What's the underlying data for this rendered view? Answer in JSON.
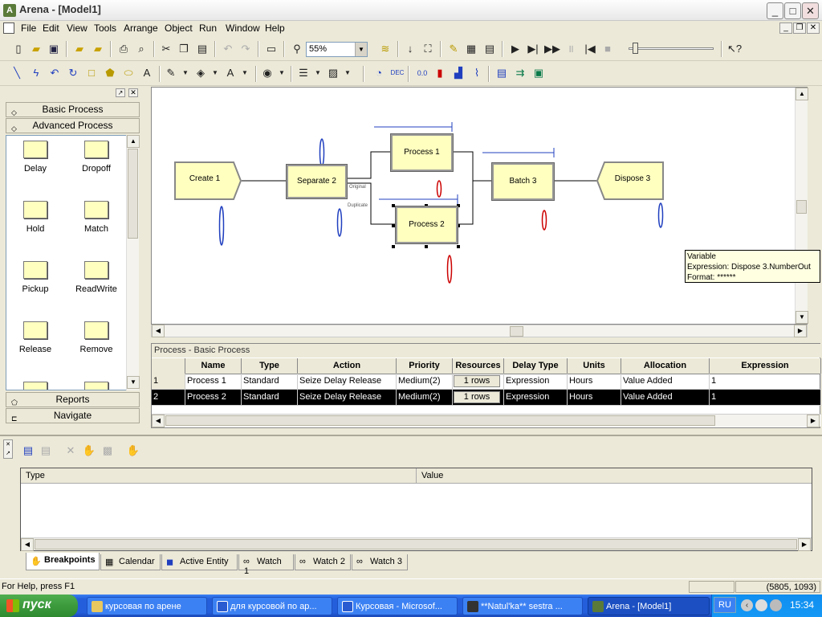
{
  "window": {
    "title": "Arena - [Model1]"
  },
  "menu": [
    "File",
    "Edit",
    "View",
    "Tools",
    "Arrange",
    "Object",
    "Run",
    "Window",
    "Help"
  ],
  "toolbar": {
    "zoom": "55%"
  },
  "project_bar": {
    "panels": [
      "Basic Process",
      "Advanced Process",
      "Reports",
      "Navigate"
    ],
    "shapes": [
      "Delay",
      "Dropoff",
      "Hold",
      "Match",
      "Pickup",
      "ReadWrite",
      "Release",
      "Remove"
    ]
  },
  "canvas": {
    "modules": {
      "create": "Create 1",
      "separate": "Separate 2",
      "process1": "Process 1",
      "process2": "Process 2",
      "batch": "Batch 3",
      "dispose": "Dispose 3"
    },
    "branch_labels": {
      "original": "Original",
      "duplicate": "Duplicate"
    },
    "tooltip": {
      "line1": "Variable",
      "line2": "Expression: Dispose 3.NumberOut",
      "line3": "Format: ******"
    }
  },
  "sheet": {
    "title": "Process - Basic Process",
    "columns": [
      "Name",
      "Type",
      "Action",
      "Priority",
      "Resources",
      "Delay Type",
      "Units",
      "Allocation",
      "Expression"
    ],
    "rows": [
      {
        "num": "1",
        "name": "Process 1",
        "type": "Standard",
        "action": "Seize Delay Release",
        "priority": "Medium(2)",
        "resources": "1 rows",
        "delay_type": "Expression",
        "units": "Hours",
        "allocation": "Value Added",
        "expression": "1"
      },
      {
        "num": "2",
        "name": "Process 2",
        "type": "Standard",
        "action": "Seize Delay Release",
        "priority": "Medium(2)",
        "resources": "1 rows",
        "delay_type": "Expression",
        "units": "Hours",
        "allocation": "Value Added",
        "expression": "1"
      }
    ]
  },
  "debug": {
    "columns": [
      "Type",
      "Value"
    ],
    "tabs": [
      "Breakpoints",
      "Calendar",
      "Active Entity",
      "Watch 1",
      "Watch 2",
      "Watch 3"
    ]
  },
  "status": {
    "help": "For Help, press F1",
    "coords": "(5805, 1093)"
  },
  "taskbar": {
    "start": "пуск",
    "tasks": [
      "курсовая по арене",
      "для курсовой по ар...",
      "Курсовая - Microsof...",
      "**Natul'ka** sestra ...",
      "Arena - [Model1]"
    ],
    "lang": "RU",
    "time": "15:34"
  }
}
